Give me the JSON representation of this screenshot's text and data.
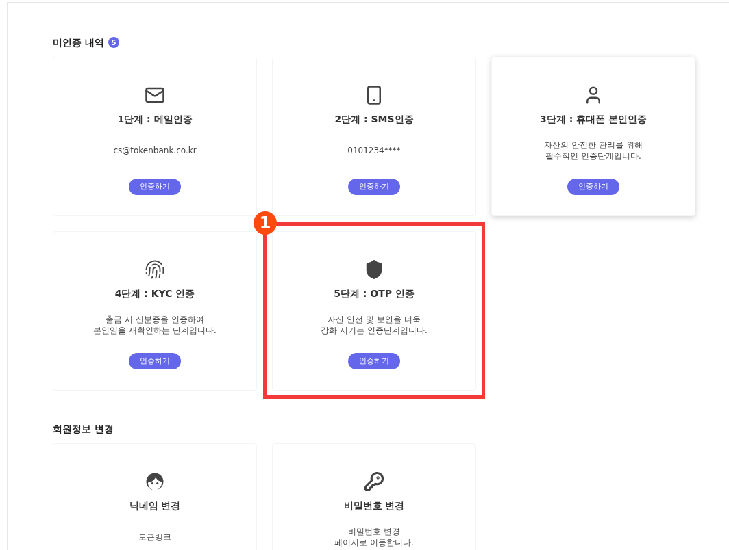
{
  "sections": [
    {
      "title": "미인증 내역",
      "count": "5",
      "cards": [
        {
          "kind": "mail",
          "title": "1단계 : 메일인증",
          "description": [
            "cs@tokenbank.co.kr"
          ],
          "button": "인증하기",
          "raised": false
        },
        {
          "kind": "phone",
          "title": "2단계 : SMS인증",
          "description": [
            "0101234****"
          ],
          "button": "인증하기",
          "raised": false
        },
        {
          "kind": "person",
          "title": "3단계 : 휴대폰 본인인증",
          "description": [
            "자산의 안전한 관리를 위해",
            "필수적인 인증단계입니다."
          ],
          "button": "인증하기",
          "raised": true
        },
        {
          "kind": "fingerprint",
          "title": "4단계 : KYC 인증",
          "description": [
            "출금 시 신분증을 인증하여",
            "본인임을 재확인하는 단계입니다."
          ],
          "button": "인증하기",
          "raised": false
        },
        {
          "kind": "shield",
          "title": "5단계 : OTP 인증",
          "description": [
            "자산 안전 및 보안을 더욱",
            "강화 시키는 인증단계입니다."
          ],
          "button": "인증하기",
          "raised": false,
          "callout": "1"
        }
      ]
    },
    {
      "title": "회원정보 변경",
      "cards": [
        {
          "kind": "face",
          "title": "닉네임 변경",
          "description": [
            "토큰뱅크"
          ],
          "raised": false
        },
        {
          "kind": "key",
          "title": "비밀번호 변경",
          "description": [
            "비밀번호 변경",
            "페이지로 이동합니다."
          ],
          "raised": false
        }
      ]
    }
  ]
}
